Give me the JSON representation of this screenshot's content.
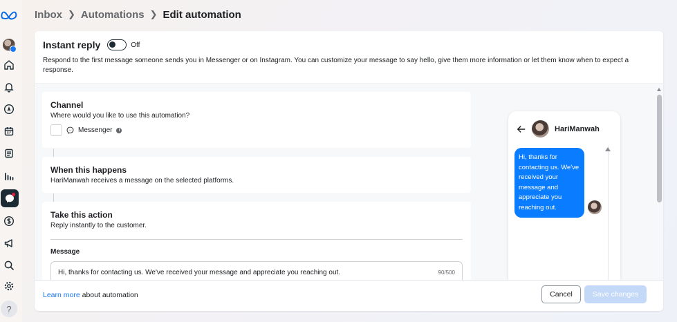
{
  "breadcrumb": {
    "items": [
      "Inbox",
      "Automations"
    ],
    "current": "Edit automation"
  },
  "instant_reply": {
    "title": "Instant reply",
    "toggle_state": "Off",
    "description": "Respond to the first message someone sends you in Messenger or on Instagram. You can customize your message to say hello, give them more information or let them know when to expect a response."
  },
  "channel": {
    "title": "Channel",
    "subtitle": "Where would you like to use this automation?",
    "option_label": "Messenger"
  },
  "trigger": {
    "title": "When this happens",
    "subtitle": "HariManwah receives a message on the selected platforms."
  },
  "action": {
    "title": "Take this action",
    "subtitle": "Reply instantly to the customer.",
    "message_label": "Message",
    "message_value": "Hi, thanks for contacting us. We've received your message and appreciate you reaching out.",
    "char_count": "90/500"
  },
  "preview": {
    "name": "HariManwah",
    "bubble_text": "Hi, thanks for contacting us. We've received your message and appreciate you reaching out."
  },
  "footer": {
    "learn_more": "Learn more",
    "about": " about automation",
    "cancel": "Cancel",
    "save": "Save changes"
  },
  "icons": {
    "brand": "meta-logo-icon",
    "nav": [
      "profile-avatar",
      "home-icon",
      "bell-icon",
      "compass-icon",
      "calendar-icon",
      "posts-icon",
      "insights-icon",
      "inbox-icon",
      "dollar-icon",
      "megaphone-icon",
      "search-icon",
      "gear-icon",
      "help-icon"
    ]
  },
  "colors": {
    "accent": "#1877f2",
    "bubble": "#0a7cff",
    "save_disabled": "#c3d9f7",
    "rail_active": "#1c2b33"
  }
}
